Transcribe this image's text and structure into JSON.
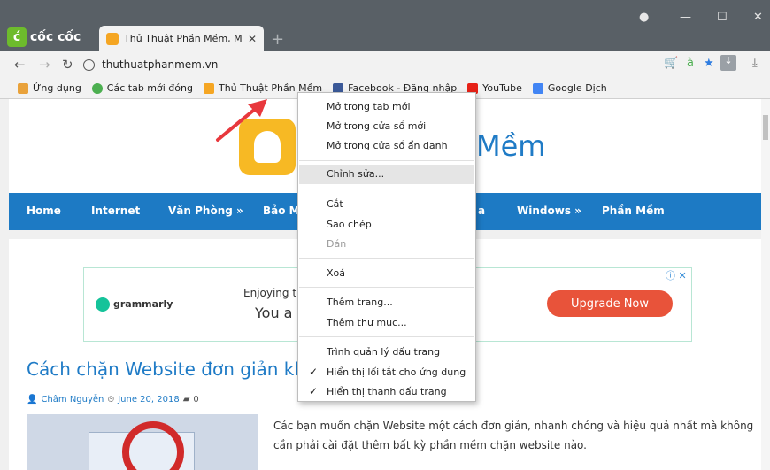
{
  "browser": {
    "logo_text": "cốc cốc",
    "tab_title": "Thủ Thuật Phần Mềm, Mẹ",
    "url": "thuthuatphanmem.vn",
    "bookmarks": [
      "Ứng dụng",
      "Các tab mới đóng",
      "Thủ Thuật Phần Mềm",
      "Facebook - Đăng nhập",
      "YouTube",
      "Google Dịch"
    ]
  },
  "site": {
    "name": "Mềm",
    "menu": [
      "Home",
      "Internet",
      "Văn Phòng »",
      "Bảo M",
      "a",
      "Windows »",
      "Phần Mềm"
    ]
  },
  "ad": {
    "brand": "grammarly",
    "line1": "Enjoying t",
    "line2": "You a",
    "button": "Upgrade Now"
  },
  "post": {
    "title": "Cách chặn Website đơn giản khô",
    "author": "Châm Nguyễn",
    "date": "June 20, 2018",
    "comments": "0",
    "excerpt": "Các bạn muốn chặn Website một cách đơn giản, nhanh chóng và hiệu quả nhất mà không cần phải cài đặt thêm bất kỳ phần mềm chặn website nào."
  },
  "context_menu": {
    "open_new_tab": "Mở trong tab mới",
    "open_new_window": "Mở trong cửa sổ mới",
    "open_incognito": "Mở trong cửa sổ ẩn danh",
    "edit": "Chỉnh sửa...",
    "cut": "Cắt",
    "copy": "Sao chép",
    "paste": "Dán",
    "delete": "Xoá",
    "add_page": "Thêm trang...",
    "add_folder": "Thêm thư mục...",
    "bookmark_manager": "Trình quản lý dấu trang",
    "show_apps_shortcut": "Hiển thị lối tắt cho ứng dụng",
    "show_bookmarks_bar": "Hiển thị thanh dấu trang"
  }
}
